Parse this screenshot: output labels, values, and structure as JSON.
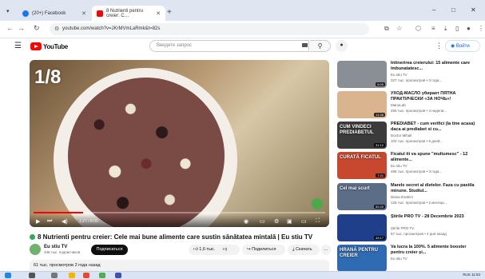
{
  "browser": {
    "tabs": [
      {
        "label": "(20+) Facebook",
        "favicon_color": "#1877f2"
      },
      {
        "label": "8 Nutrienti pentru creier: C…",
        "favicon_color": "#ff0000"
      }
    ],
    "new_tab": "+",
    "url": "youtube.com/watch?v=JKrMVmLaRmk&t=82s",
    "window_controls": [
      "–",
      "□",
      "✕"
    ]
  },
  "youtube": {
    "logo_text": "YouTube",
    "search_placeholder": "Введите запрос",
    "signin_label": "Войти"
  },
  "player": {
    "slide_label": "1/8",
    "time": "1:27 / 8:00",
    "progress_fraction": 0.17
  },
  "video": {
    "title": "8 Nutrienti pentru creier: Cele mai bune alimente care sustin sănătatea mintală | Eu stiu TV",
    "channel": "Eu stiu TV",
    "subscribers": "346 тыс. подписчиков",
    "subscribe_label": "Подписаться",
    "likes": "1,6 тыс.",
    "share_label": "Поделиться",
    "download_label": "Скачать",
    "description": "61 тыс. просмотров  2 года назад"
  },
  "recommendations": [
    {
      "title": "Intinerirea creierului: 15 alimente care îmbunatatesc...",
      "channel": "Eu stiu TV",
      "meta": "327 тыс. просмотров • 3 года...",
      "duration": "6:09",
      "thumb_color": "#8a8f96",
      "thumb_text": ""
    },
    {
      "title": "УХОД-МАСЛО убирает ПЯТНА ПРАКТИЧЕСКИ «ЗА НОЧЬ»!",
      "channel": "ManoLab",
      "meta": "455 тыс. просмотров • 4 недели...",
      "duration": "11:36",
      "thumb_color": "#d9b48f",
      "thumb_text": ""
    },
    {
      "title": "PREDIABET - cum verifici (la tine acasa) daca ai prediabet si cu...",
      "channel": "Doctor Mihail",
      "meta": "102 тыс. просмотров • 5 дней...",
      "duration": "31:12",
      "thumb_color": "#3b3b3b",
      "thumb_text": "CUM VINDECI PREDIABETUL"
    },
    {
      "title": "Ficatul iti va spune \"multumesc\" - 12 alimente...",
      "channel": "Eu stiu TV",
      "meta": "466 тыс. просмотров • 3 года...",
      "duration": "7:21",
      "thumb_color": "#c7482f",
      "thumb_text": "CURATĂ FICATUL"
    },
    {
      "title": "Marele secret al dietelor. Faza cu pastila minune. Studiul...",
      "channel": "Diana Ibrahim",
      "meta": "125 тыс. просмотров • 2 месяца...",
      "duration": "52:20",
      "thumb_color": "#5c6d88",
      "thumb_text": "Cel mai scurt"
    },
    {
      "title": "Știrile PRO TV - 28 Decembrie 2023",
      "channel": "Știrile PRO TV",
      "meta": "57 тыс. просмотров • 4 дня назад",
      "duration": "43:17",
      "thumb_color": "#1f3f8a",
      "thumb_text": ""
    },
    {
      "title": "Va lucra la 100%. 5 alimente booster pentru creier și...",
      "channel": "Eu stiu TV",
      "meta": "",
      "duration": "",
      "thumb_color": "#2f6bb3",
      "thumb_text": "HRANĂ PENTRU CREIER"
    }
  ],
  "taskbar": {
    "tray_text": "RUS  11:53"
  }
}
